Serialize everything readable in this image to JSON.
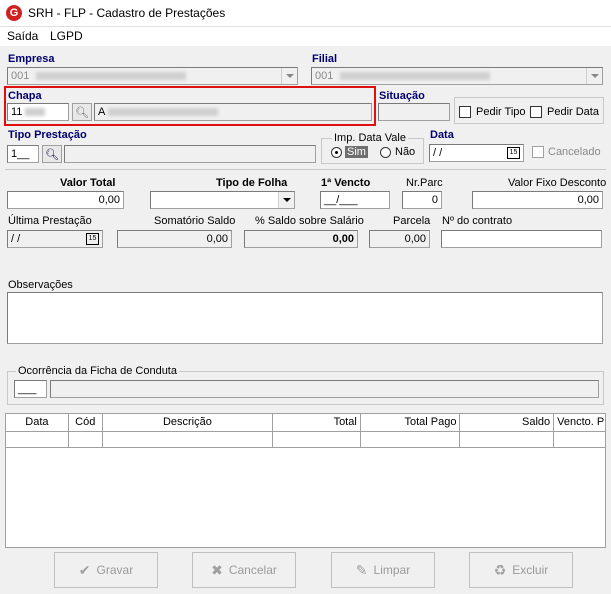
{
  "window": {
    "title": "SRH - FLP - Cadastro de Prestações",
    "logo_letter": "G"
  },
  "menu": [
    {
      "label": "Saída"
    },
    {
      "label": "LGPD"
    }
  ],
  "empresa": {
    "label": "Empresa",
    "value": "001"
  },
  "filial": {
    "label": "Filial",
    "value": "001"
  },
  "chapa": {
    "label": "Chapa",
    "value": "11",
    "name_prefix": "A"
  },
  "situacao": {
    "label": "Situação",
    "value": ""
  },
  "pedir_tipo": {
    "label": "Pedir Tipo",
    "checked": false
  },
  "pedir_data": {
    "label": "Pedir Data",
    "checked": false
  },
  "tipo_prestacao": {
    "label": "Tipo Prestação",
    "value": "1__",
    "descricao": ""
  },
  "imp_data_vale": {
    "label": "Imp. Data Vale",
    "options": [
      "Sim",
      "Não"
    ],
    "selected": "Sim"
  },
  "data": {
    "label": "Data",
    "value": " /  /",
    "calendar_text": "15"
  },
  "cancelado": {
    "label": "Cancelado",
    "checked": false
  },
  "valor_total": {
    "label": "Valor Total",
    "value": "0,00"
  },
  "tipo_folha": {
    "label": "Tipo de Folha",
    "value": ""
  },
  "primeiro_vencto": {
    "label": "1ª Vencto",
    "value": "__/___"
  },
  "nr_parc": {
    "label": "Nr.Parc",
    "value": "0"
  },
  "valor_fixo_desconto": {
    "label": "Valor Fixo Desconto",
    "value": "0,00"
  },
  "ultima_prestacao": {
    "label": "Última Prestação",
    "value": " /  /",
    "calendar_text": "15"
  },
  "somatorio_saldo": {
    "label": "Somatório Saldo",
    "value": "0,00"
  },
  "perc_saldo_salario": {
    "label": "% Saldo sobre Salário",
    "value": "0,00"
  },
  "parcela": {
    "label": "Parcela",
    "value": "0,00"
  },
  "nr_contrato": {
    "label": "Nº do contrato",
    "value": ""
  },
  "observacoes": {
    "label": "Observações",
    "value": ""
  },
  "ocorrencia": {
    "label": "Ocorrência da Ficha de Conduta",
    "code": "___",
    "descricao": ""
  },
  "grid": {
    "columns": [
      "Data",
      "Cód",
      "Descrição",
      "Total",
      "Total Pago",
      "Saldo",
      "Vencto. Pre"
    ]
  },
  "buttons": {
    "gravar": "Gravar",
    "cancelar": "Cancelar",
    "limpar": "Limpar",
    "excluir": "Excluir"
  },
  "colors": {
    "label_blue": "#000070",
    "highlight": "#e01010"
  }
}
